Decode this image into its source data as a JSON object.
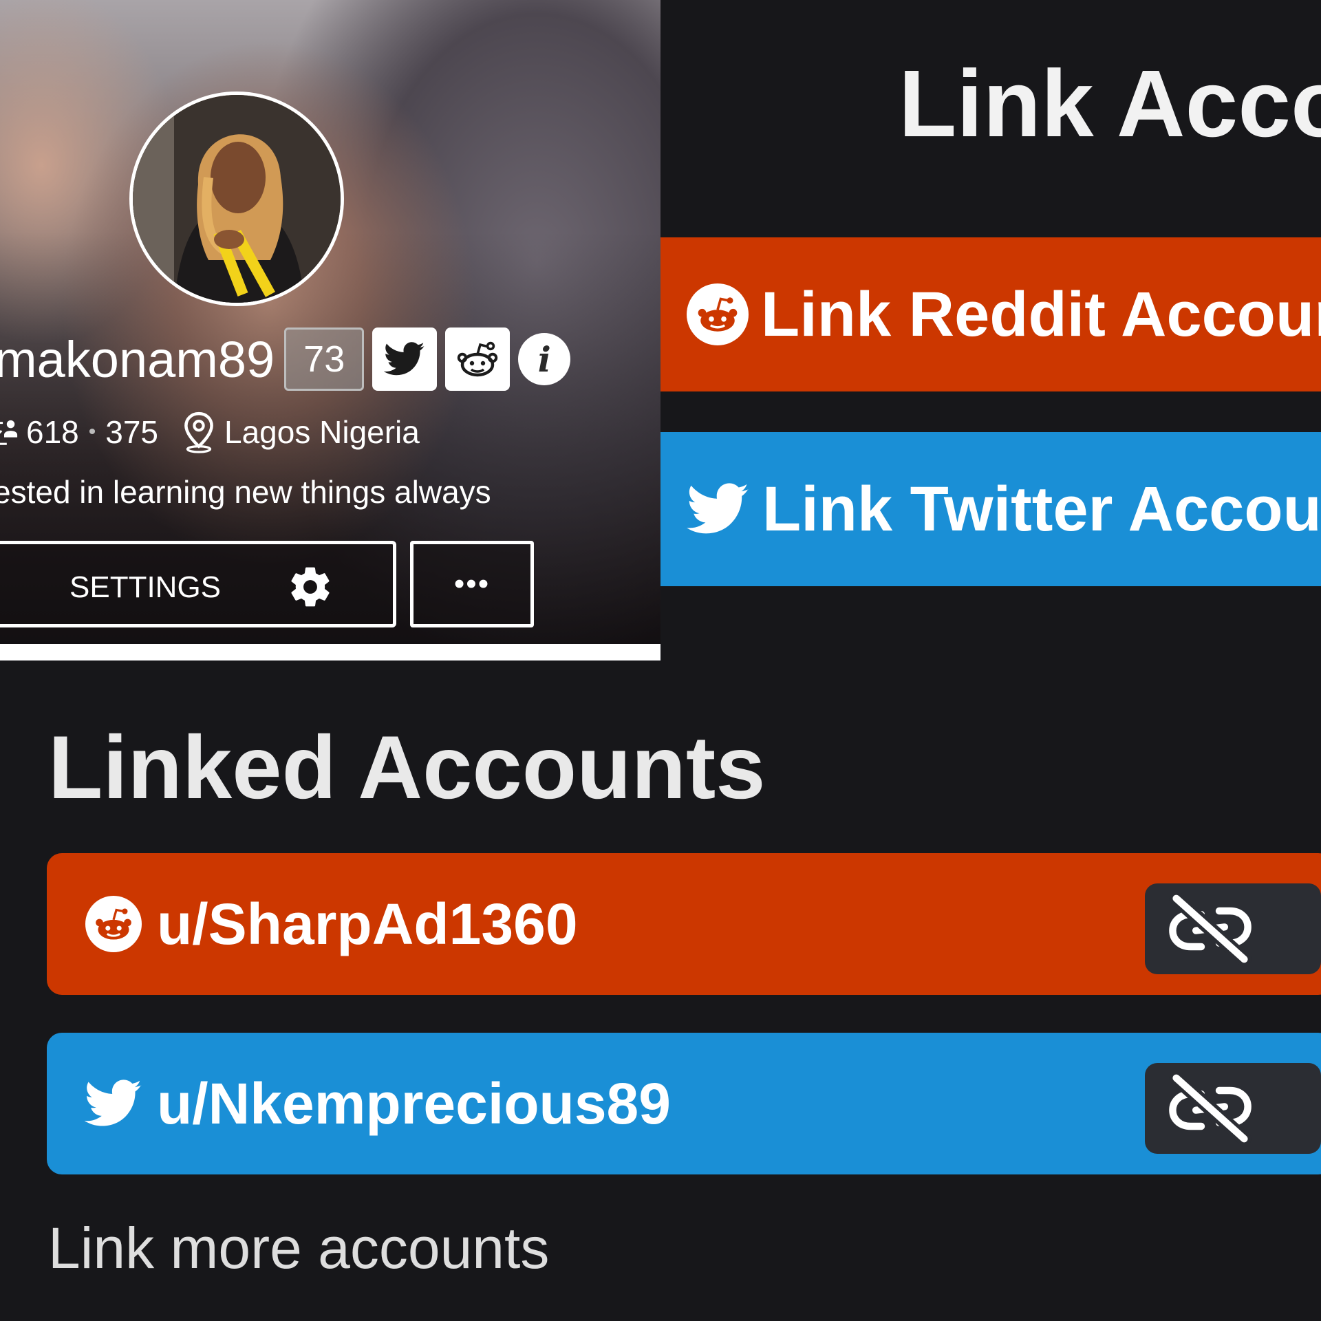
{
  "profile": {
    "username": "makonam89",
    "karma": "73",
    "following": "618",
    "followers": "375",
    "location": "Lagos Nigeria",
    "bio": "ested in learning new things always",
    "settings_label": "SETTINGS",
    "more_label": "•••"
  },
  "link_section": {
    "title": "Link Acco",
    "reddit_label": "Link Reddit Account",
    "twitter_label": "Link Twitter Account"
  },
  "linked_section": {
    "title": "Linked Accounts",
    "accounts": [
      {
        "platform": "reddit",
        "handle": "u/SharpAd1360"
      },
      {
        "platform": "twitter",
        "handle": "u/Nkemprecious89"
      }
    ],
    "more_label": "Link more accounts"
  },
  "colors": {
    "reddit": "#cc3700",
    "twitter": "#1a8fd6",
    "background": "#17171a",
    "unlink_button": "#2b2d33"
  },
  "icons": [
    "reddit-icon",
    "twitter-icon",
    "info-icon",
    "gear-icon",
    "location-pin-icon",
    "followers-icon",
    "unlink-icon"
  ]
}
